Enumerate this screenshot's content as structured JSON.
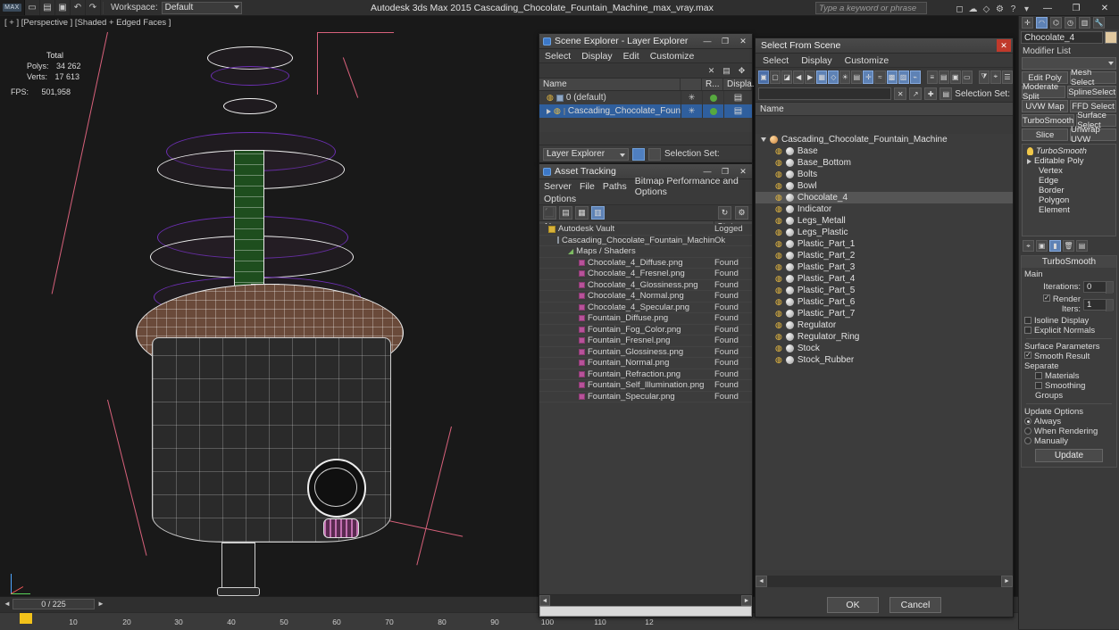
{
  "titlebar": {
    "logo": "MAX",
    "workspace_label": "Workspace:",
    "workspace_value": "Default",
    "app_title": "Autodesk 3ds Max  2015    Cascading_Chocolate_Fountain_Machine_max_vray.max",
    "search_placeholder": "Type a keyword or phrase",
    "icons": [
      "undo-icon",
      "redo-icon",
      "select-icon",
      "link-icon",
      "unlink-icon",
      "bind-icon",
      "filter-icon"
    ],
    "right_icons": [
      "sign-in-icon",
      "cloud-icon",
      "help-icon"
    ],
    "window_buttons": [
      "minimize",
      "restore",
      "close"
    ]
  },
  "viewport": {
    "label": "[ + ] [Perspective ] [Shaded + Edged Faces ]",
    "stats": {
      "header": "Total",
      "rows": [
        {
          "name": "Polys:",
          "value": "34 262"
        },
        {
          "name": "Verts:",
          "value": "17 613"
        }
      ],
      "fps_label": "FPS:",
      "fps_value": "501,958"
    }
  },
  "timeline": {
    "frame_field": "0 / 225",
    "ticks": [
      "10",
      "20",
      "30",
      "40",
      "50",
      "60",
      "70",
      "80",
      "90",
      "100",
      "110",
      "12"
    ]
  },
  "scene_explorer": {
    "title": "Scene Explorer - Layer Explorer",
    "menus": [
      "Select",
      "Display",
      "Edit",
      "Customize"
    ],
    "columns": [
      "Name",
      "",
      "R...",
      "Displa..."
    ],
    "rows": [
      {
        "name": "0 (default)",
        "icon": "lightbulb-icon",
        "selected": false
      },
      {
        "name": "Cascading_Chocolate_Fountain_Mac...",
        "icon": "lightbulb-icon",
        "selected": true
      }
    ],
    "footer_combo": "Layer Explorer",
    "footer_selection_set_label": "Selection Set:",
    "window_buttons": [
      "minimize",
      "restore",
      "close"
    ]
  },
  "asset_tracking": {
    "title": "Asset Tracking",
    "menus": [
      "Server",
      "File",
      "Paths",
      "Bitmap Performance and Options"
    ],
    "columns": [
      "Name",
      "Status"
    ],
    "rows": [
      {
        "name": "Autodesk Vault",
        "status": "Logged",
        "icon": "vault-icon",
        "indent": 0
      },
      {
        "name": "Cascading_Chocolate_Fountain_Machine_max_...",
        "status": "Ok",
        "icon": "file-icon",
        "indent": 1
      },
      {
        "name": "Maps / Shaders",
        "status": "",
        "icon": "folder-icon",
        "indent": 2
      },
      {
        "name": "Chocolate_4_Diffuse.png",
        "status": "Found",
        "icon": "map-icon",
        "indent": 3
      },
      {
        "name": "Chocolate_4_Fresnel.png",
        "status": "Found",
        "icon": "map-icon",
        "indent": 3
      },
      {
        "name": "Chocolate_4_Glossiness.png",
        "status": "Found",
        "icon": "map-icon",
        "indent": 3
      },
      {
        "name": "Chocolate_4_Normal.png",
        "status": "Found",
        "icon": "map-icon",
        "indent": 3
      },
      {
        "name": "Chocolate_4_Specular.png",
        "status": "Found",
        "icon": "map-icon",
        "indent": 3
      },
      {
        "name": "Fountain_Diffuse.png",
        "status": "Found",
        "icon": "map-icon",
        "indent": 3
      },
      {
        "name": "Fountain_Fog_Color.png",
        "status": "Found",
        "icon": "map-icon",
        "indent": 3
      },
      {
        "name": "Fountain_Fresnel.png",
        "status": "Found",
        "icon": "map-icon",
        "indent": 3
      },
      {
        "name": "Fountain_Glossiness.png",
        "status": "Found",
        "icon": "map-icon",
        "indent": 3
      },
      {
        "name": "Fountain_Normal.png",
        "status": "Found",
        "icon": "map-icon",
        "indent": 3
      },
      {
        "name": "Fountain_Refraction.png",
        "status": "Found",
        "icon": "map-icon",
        "indent": 3
      },
      {
        "name": "Fountain_Self_Illumination.png",
        "status": "Found",
        "icon": "map-icon",
        "indent": 3
      },
      {
        "name": "Fountain_Specular.png",
        "status": "Found",
        "icon": "map-icon",
        "indent": 3
      }
    ],
    "window_buttons": [
      "minimize",
      "restore",
      "close"
    ]
  },
  "select_from_scene": {
    "title": "Select From Scene",
    "menus": [
      "Select",
      "Display",
      "Customize"
    ],
    "selection_set_label": "Selection Set:",
    "column_header": "Name",
    "root": "Cascading_Chocolate_Fountain_Machine",
    "items": [
      {
        "name": "Base",
        "selected": false
      },
      {
        "name": "Base_Bottom",
        "selected": false
      },
      {
        "name": "Bolts",
        "selected": false
      },
      {
        "name": "Bowl",
        "selected": false
      },
      {
        "name": "Chocolate_4",
        "selected": true
      },
      {
        "name": "Indicator",
        "selected": false
      },
      {
        "name": "Legs_Metall",
        "selected": false
      },
      {
        "name": "Legs_Plastic",
        "selected": false
      },
      {
        "name": "Plastic_Part_1",
        "selected": false
      },
      {
        "name": "Plastic_Part_2",
        "selected": false
      },
      {
        "name": "Plastic_Part_3",
        "selected": false
      },
      {
        "name": "Plastic_Part_4",
        "selected": false
      },
      {
        "name": "Plastic_Part_5",
        "selected": false
      },
      {
        "name": "Plastic_Part_6",
        "selected": false
      },
      {
        "name": "Plastic_Part_7",
        "selected": false
      },
      {
        "name": "Regulator",
        "selected": false
      },
      {
        "name": "Regulator_Ring",
        "selected": false
      },
      {
        "name": "Stock",
        "selected": false
      },
      {
        "name": "Stock_Rubber",
        "selected": false
      }
    ],
    "ok_label": "OK",
    "cancel_label": "Cancel"
  },
  "command_panel": {
    "object_name": "Chocolate_4",
    "object_color": "#e1c9a0",
    "modifier_list_label": "Modifier List",
    "buttons_row1": [
      "Edit Poly",
      "Mesh Select"
    ],
    "buttons_row2": [
      "Moderate Split",
      "SplineSelect"
    ],
    "buttons_row3": [
      "UVW Map",
      "FFD Select"
    ],
    "buttons_row4": [
      "TurboSmooth",
      "Surface Select"
    ],
    "buttons_row5": [
      "Slice",
      "Unwrap UVW"
    ],
    "stack": [
      {
        "label": "TurboSmooth",
        "type": "modifier"
      },
      {
        "label": "Editable Poly",
        "type": "base"
      },
      {
        "label": "Vertex",
        "type": "sub"
      },
      {
        "label": "Edge",
        "type": "sub"
      },
      {
        "label": "Border",
        "type": "sub"
      },
      {
        "label": "Polygon",
        "type": "sub"
      },
      {
        "label": "Element",
        "type": "sub"
      }
    ],
    "rollout_title": "TurboSmooth",
    "main_label": "Main",
    "fields": [
      {
        "label": "Iterations:",
        "value": "0"
      },
      {
        "label": "Render Iters:",
        "value": "1"
      }
    ],
    "checkboxes": [
      {
        "label": "Isoline Display",
        "checked": false
      },
      {
        "label": "Explicit Normals",
        "checked": false
      }
    ],
    "surface_params_title": "Surface Parameters",
    "surface_params": [
      {
        "label": "Smooth Result",
        "checked": true
      }
    ],
    "separate_label": "Separate",
    "separate_options": [
      {
        "label": "Materials",
        "checked": false
      },
      {
        "label": "Smoothing Groups",
        "checked": false
      }
    ],
    "update_options_title": "Update Options",
    "update_options": [
      {
        "label": "Always",
        "selected": true
      },
      {
        "label": "When Rendering",
        "selected": false
      },
      {
        "label": "Manually",
        "selected": false
      }
    ],
    "update_button": "Update"
  }
}
